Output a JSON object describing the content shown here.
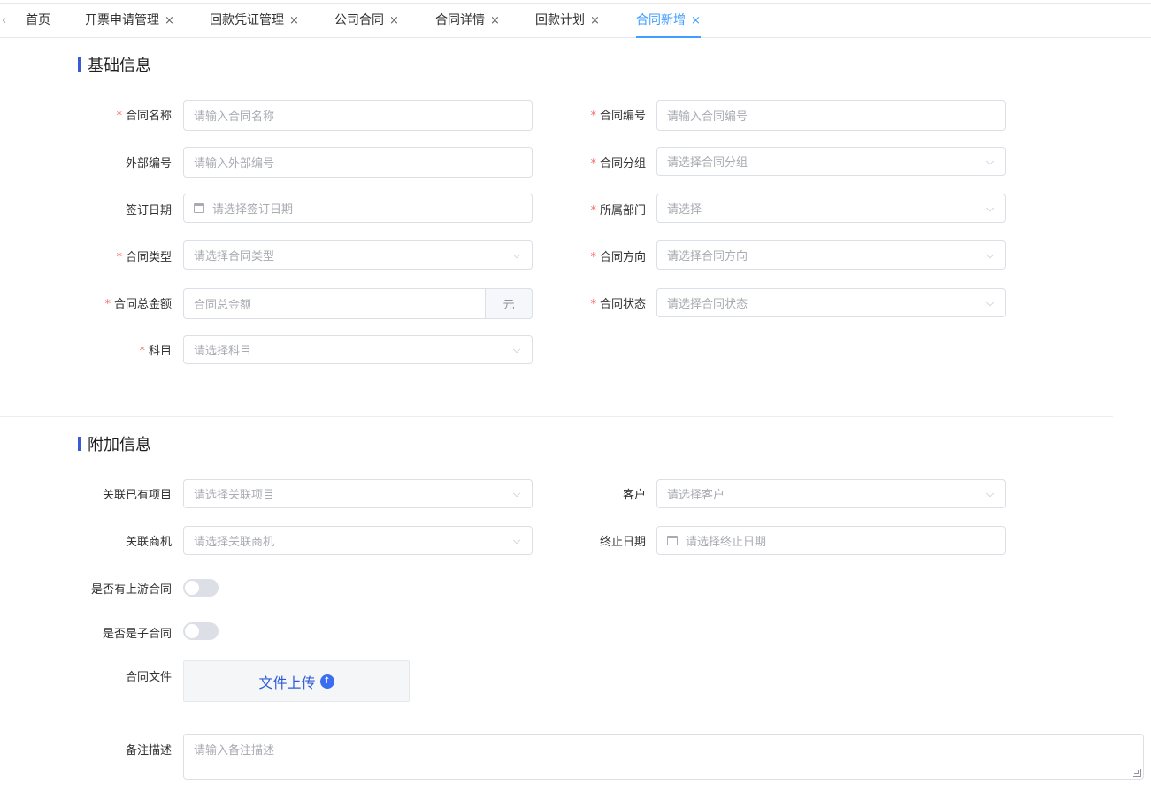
{
  "tabs": {
    "prev_icon": "‹",
    "items": [
      {
        "label": "首页",
        "closable": false
      },
      {
        "label": "开票申请管理",
        "closable": true
      },
      {
        "label": "回款凭证管理",
        "closable": true
      },
      {
        "label": "公司合同",
        "closable": true
      },
      {
        "label": "合同详情",
        "closable": true
      },
      {
        "label": "回款计划",
        "closable": true
      },
      {
        "label": "合同新增",
        "closable": true,
        "active": true
      }
    ],
    "close_glyph": "×"
  },
  "basic": {
    "title": "基础信息",
    "contract_name": {
      "label": "合同名称",
      "placeholder": "请输入合同名称"
    },
    "contract_no": {
      "label": "合同编号",
      "placeholder": "请输入合同编号"
    },
    "external_no": {
      "label": "外部编号",
      "placeholder": "请输入外部编号"
    },
    "contract_group": {
      "label": "合同分组",
      "placeholder": "请选择合同分组"
    },
    "sign_date": {
      "label": "签订日期",
      "placeholder": "请选择签订日期"
    },
    "department": {
      "label": "所属部门",
      "placeholder": "请选择"
    },
    "contract_type": {
      "label": "合同类型",
      "placeholder": "请选择合同类型"
    },
    "contract_direction": {
      "label": "合同方向",
      "placeholder": "请选择合同方向"
    },
    "total_amount": {
      "label": "合同总金额",
      "placeholder": "合同总金额",
      "suffix": "元"
    },
    "contract_status": {
      "label": "合同状态",
      "placeholder": "请选择合同状态"
    },
    "subject": {
      "label": "科目",
      "placeholder": "请选择科目"
    }
  },
  "extra": {
    "title": "附加信息",
    "related_project": {
      "label": "关联已有项目",
      "placeholder": "请选择关联项目"
    },
    "customer": {
      "label": "客户",
      "placeholder": "请选择客户"
    },
    "related_opportunity": {
      "label": "关联商机",
      "placeholder": "请选择关联商机"
    },
    "end_date": {
      "label": "终止日期",
      "placeholder": "请选择终止日期"
    },
    "has_upstream": {
      "label": "是否有上游合同",
      "on": false
    },
    "is_sub": {
      "label": "是否是子合同",
      "on": false
    },
    "contract_file": {
      "label": "合同文件",
      "upload_label": "文件上传",
      "upload_icon": "↑"
    },
    "remark": {
      "label": "备注描述",
      "placeholder": "请输入备注描述"
    }
  },
  "required_mark": "*",
  "chevron": "⌵",
  "colors": {
    "accent": "#409eff",
    "section_bar": "#3d5ad6",
    "required": "#f56c6c",
    "upload_text": "#2f5bd8"
  }
}
